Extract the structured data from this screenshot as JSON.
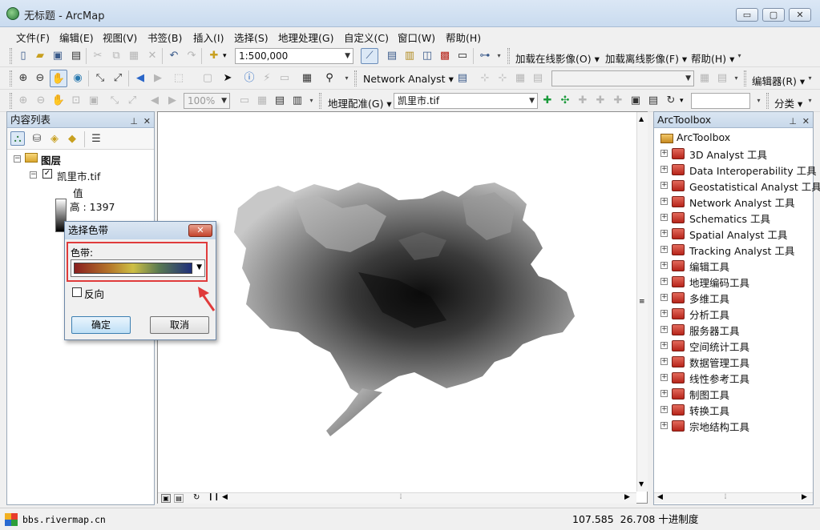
{
  "window": {
    "title": "无标题 - ArcMap",
    "minimize": "▭",
    "maximize": "▢",
    "close": "✕"
  },
  "menu": [
    "文件(F)",
    "编辑(E)",
    "视图(V)",
    "书签(B)",
    "插入(I)",
    "选择(S)",
    "地理处理(G)",
    "自定义(C)",
    "窗口(W)",
    "帮助(H)"
  ],
  "toolbar": {
    "scale": "1:500,000",
    "online_imagery": "加载在线影像(O)",
    "offline_imagery": "加载离线影像(F)",
    "help": "帮助(H)",
    "network_analyst": "Network Analyst",
    "editor": "编辑器(R)",
    "zoom_percent": "100%",
    "georef": "地理配准(G)",
    "layer_select": "凯里市.tif",
    "classify": "分类"
  },
  "toc": {
    "title": "内容列表",
    "layers_label": "图层",
    "layer_name": "凯里市.tif",
    "value_label": "值",
    "high_label": "高 : 1397"
  },
  "toolbox": {
    "title": "ArcToolbox",
    "root": "ArcToolbox",
    "items": [
      "3D Analyst 工具",
      "Data Interoperability 工具",
      "Geostatistical Analyst 工具",
      "Network Analyst 工具",
      "Schematics 工具",
      "Spatial Analyst 工具",
      "Tracking Analyst 工具",
      "编辑工具",
      "地理编码工具",
      "多维工具",
      "分析工具",
      "服务器工具",
      "空间统计工具",
      "数据管理工具",
      "线性参考工具",
      "制图工具",
      "转换工具",
      "宗地结构工具"
    ]
  },
  "dialog": {
    "title": "选择色带",
    "ramp_label": "色带:",
    "reverse_label": "反向",
    "ok": "确定",
    "cancel": "取消"
  },
  "status": {
    "watermark": "bbs.rivermap.cn",
    "coords": "107.585  26.708 十进制度"
  },
  "colors": {
    "highlight_box": "#e03b3b",
    "ramp_start": "#8a1f1f",
    "ramp_mid": "#cdbf45",
    "ramp_end": "#1f2f7a"
  }
}
